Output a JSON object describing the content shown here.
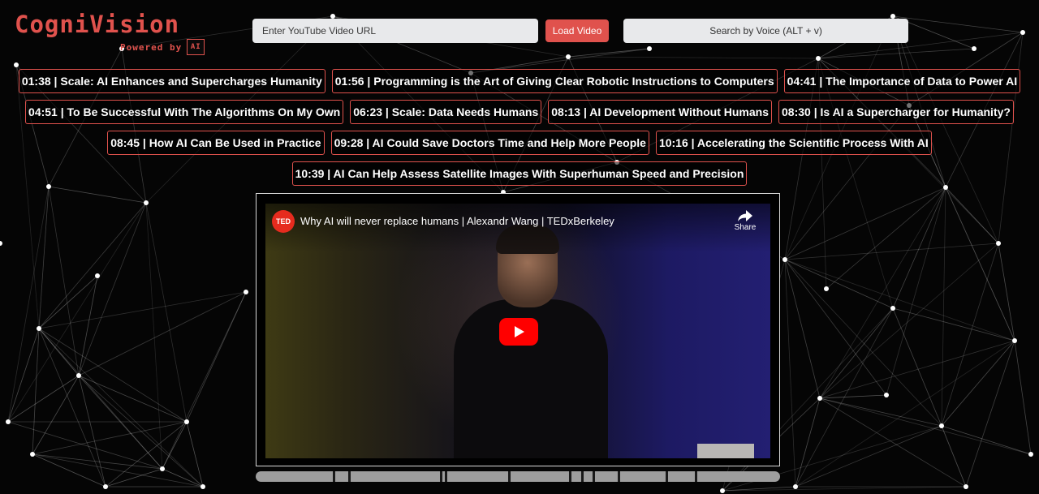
{
  "brand": {
    "title": "CogniVision",
    "subtitle": "Powered by",
    "chip_text": "AI"
  },
  "toolbar": {
    "url_placeholder": "Enter YouTube Video URL",
    "load_label": "Load Video",
    "voice_label": "Search by Voice (ALT + v)"
  },
  "chapters": [
    {
      "label": "01:38 | Scale: AI Enhances and Supercharges Humanity"
    },
    {
      "label": "01:56 | Programming is the Art of Giving Clear Robotic Instructions to Computers"
    },
    {
      "label": "04:41 | The Importance of Data to Power AI"
    },
    {
      "label": "04:51 | To Be Successful With The Algorithms On My Own"
    },
    {
      "label": "06:23 | Scale: Data Needs Humans"
    },
    {
      "label": "08:13 | AI Development Without Humans"
    },
    {
      "label": "08:30 | Is AI a Supercharger for Humanity?"
    },
    {
      "label": "08:45 | How AI Can Be Used in Practice"
    },
    {
      "label": "09:28 | AI Could Save Doctors Time and Help More People"
    },
    {
      "label": "10:16 | Accelerating the Scientific Process With AI"
    },
    {
      "label": "10:39 | AI Can Help Assess Satellite Images With Superhuman Speed and Precision"
    }
  ],
  "video": {
    "channel_logo": "TED",
    "title": "Why AI will never replace humans | Alexandr Wang | TEDxBerkeley",
    "share_label": "Share",
    "play_icon": "play-icon",
    "share_icon": "share-icon"
  },
  "timeline": {
    "chapter_fractions": [
      0.147,
      0.177,
      0.351,
      0.36,
      0.482,
      0.597,
      0.62,
      0.643,
      0.69,
      0.781,
      0.837
    ]
  },
  "colors": {
    "accent": "#e0524d",
    "background": "#050505",
    "input_bg": "#e8e9eb"
  }
}
